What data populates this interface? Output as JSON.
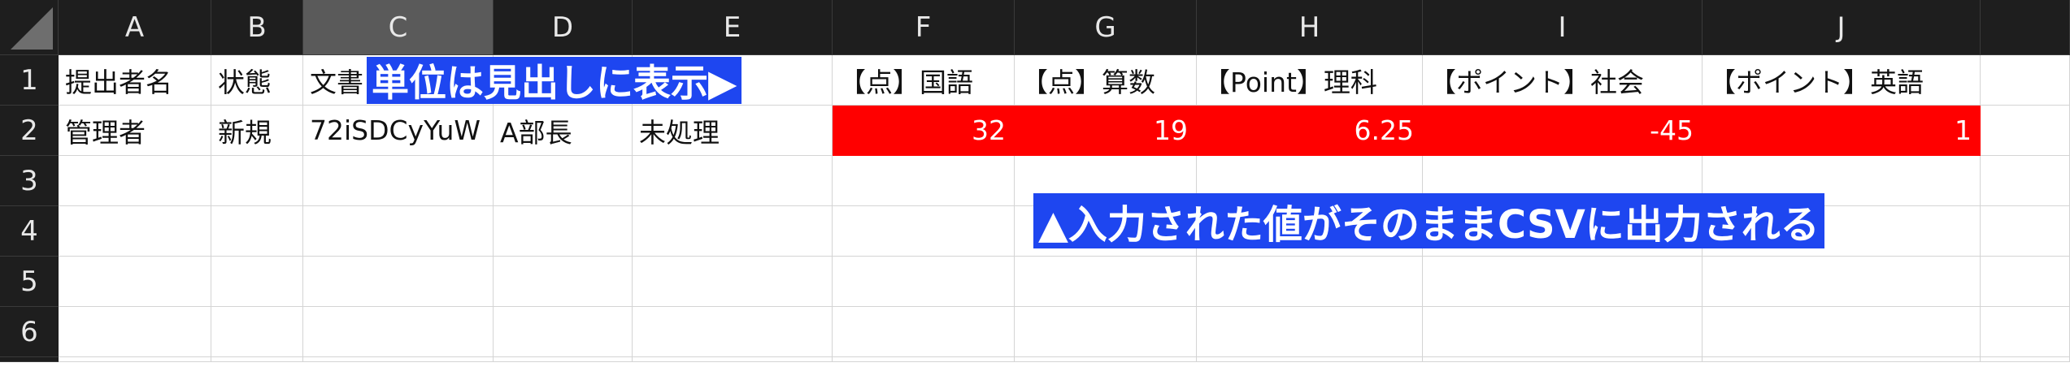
{
  "columns": [
    "A",
    "B",
    "C",
    "D",
    "E",
    "F",
    "G",
    "H",
    "I",
    "J"
  ],
  "rows": [
    "1",
    "2",
    "3",
    "4",
    "5",
    "6"
  ],
  "row1": [
    "提出者名",
    "状態",
    "文書",
    "",
    "",
    "【点】国語",
    "【点】算数",
    "【Point】理科",
    "【ポイント】社会",
    "【ポイント】英語"
  ],
  "row2": [
    "管理者",
    "新規",
    "72iSDCyYuW",
    "A部長",
    "未処理",
    "32",
    "19",
    "6.25",
    "-45",
    "1"
  ],
  "callouts": {
    "unit_note": "単位は見出しに表示▶",
    "csv_note": "▲入力された値がそのままCSVに出力される"
  },
  "colors": {
    "highlight_fill": "#ff0000",
    "callout_fill": "#1e46f0",
    "header_fill": "#1e1e1e"
  }
}
